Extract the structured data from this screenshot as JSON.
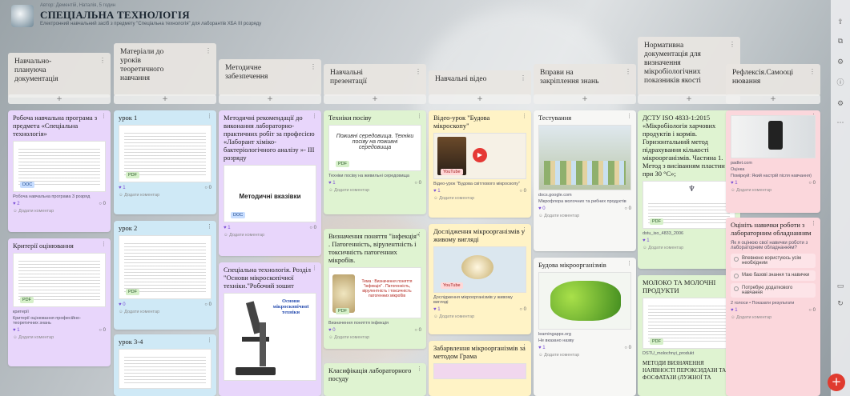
{
  "header": {
    "small": "Автор: Дементій, Наталія, 5 годин",
    "title": "СПЕЦІАЛЬНА ТЕХНОЛОГІЯ",
    "subtitle": "Електронний навчальний засіб з предмету \"Спеціальна технологія\" для лаборантів ХБА ІІІ розряду"
  },
  "columns": [
    {
      "title": "Навчально-\nплануюча\nдокументація",
      "cards": [
        {
          "title": "Робоча навчальна програма з предмета «Спеціальна технологія»",
          "badge": "DOC",
          "meta": "Робоча навчальна програма 3 розряд",
          "likes": "2",
          "comments": "0",
          "comment_label": "Додати коментар"
        },
        {
          "title": "Критерії оцінювання",
          "badge": "PDF",
          "meta": "критерії",
          "meta2": "Критерії оцінювання професійно-теоретичних знань",
          "likes": "1",
          "comments": "0",
          "comment_label": "Додати коментар"
        }
      ]
    },
    {
      "title": "Матеріали до\nуроків\nтеоретичного\nнавчання",
      "cards": [
        {
          "title": "урок 1",
          "badge": "PDF",
          "likes": "1",
          "comments": "0",
          "comment_label": "Додати коментар"
        },
        {
          "title": "урок 2",
          "badge": "PDF",
          "likes": "0",
          "comments": "0",
          "comment_label": "Додати коментар"
        },
        {
          "title": "урок 3-4"
        }
      ]
    },
    {
      "title": "Методичне\nзабезпечення",
      "cards": [
        {
          "title": "Методичні рекомендації до виконання лабораторно-практичних робіт за професією «Лаборант хіміко-бактеріологічного аналізу »- ІІІ розряду",
          "thumb_caption": "Методичні вказівки",
          "badge": "DOC",
          "likes": "1",
          "comments": "0",
          "comment_label": "Додати коментар"
        },
        {
          "title": "Спеціальна технологія. Розділ \"Основи мікроскопічної техніки.\"Робочий зошит",
          "thumb_caption": "Основи мікроскопічної техніки"
        }
      ]
    },
    {
      "title": "Навчальні\nпрезентації",
      "cards": [
        {
          "title": "Техніки посіву",
          "thumb_caption": "Поживні середовища. Техніки посіву на поживні середовища",
          "badge": "PDF",
          "meta": "Техніки посіву на живильні середовища",
          "likes": "1",
          "comments": "0",
          "comment_label": "Додати коментар"
        },
        {
          "title": "Визначення поняття \"інфекція\" . Патогенність, вірулентність і токсичність патогенних мікробів.",
          "thumb_caption": "Тема : Визначення поняття \"інфекція\" . Патогенність, вірулентність і токсичність патогенних мікробів",
          "badge": "PDF",
          "meta": "Визначення поняття інфекція",
          "likes": "0",
          "comments": "0",
          "comment_label": "Додати коментар"
        },
        {
          "title": "Класифікація лабораторного посуду"
        }
      ]
    },
    {
      "title": "Навчальні відео",
      "cards": [
        {
          "title": "Відео-урок \"Будова мікроскопу\"",
          "badge": "YouTube",
          "meta": "Відео-урок \"Будова світлового мікроскопу\"",
          "likes": "1",
          "comments": "0",
          "comment_label": "Додати коментар"
        },
        {
          "title": "Дослідження мікроорганізмів у живому вигляді",
          "badge": "YouTube",
          "meta": "Дослідження мікроорганізмів у живому вигляді",
          "likes": "1",
          "comments": "0",
          "comment_label": "Додати коментар"
        },
        {
          "title": "Забарвлення мікроорганізмів за методом Грама"
        }
      ]
    },
    {
      "title": "Вправи на\nзакріплення знань",
      "cards": [
        {
          "title": "Тестування",
          "meta": "docs.google.com",
          "meta2": "Мікрофлора молочних та рибних продуктів",
          "likes": "0",
          "comments": "0",
          "comment_label": "Додати коментар"
        },
        {
          "title": "Будова мікроорганізмів",
          "meta": "learningapps.org",
          "meta2": "Не вказано назву",
          "likes": "1",
          "comments": "0",
          "comment_label": "Додати коментар"
        }
      ]
    },
    {
      "title": "Нормативна\nдокументація для\nвизначення\nмікробіологічних\nпоказників якості",
      "cards": [
        {
          "title": "ДСТУ ISO 4833-1:2015 «Мікробіологія харчових продуктів і кормів. Горизонтальний метод підрахування кількості мікроорганізмів. Частина 1. Метод з висіванням пластин при 30 °С»;",
          "badge": "PDF",
          "meta": "dstu_iso_4833_2006",
          "likes": "1",
          "comments": "0",
          "comment_label": "Додати коментар"
        },
        {
          "title": "МОЛОКО ТА МОЛОЧНІ ПРОДУКТИ",
          "badge": "PDF",
          "meta": "DSTU_molochnyi_produkt",
          "meta2": "МЕТОДИ ВИЗНАЧЕННЯ НАЯВНОСТІ ПЕРОКСИДАЗИ ТА ФОСФАТАЗИ (ЛУЖНОЇ ТА"
        }
      ]
    },
    {
      "title": "Рефлексія.Самооці\nнювання",
      "cards": [
        {
          "title": "",
          "meta": "padlet.com",
          "meta0": "Оцінка",
          "meta2": "Поміркуй: Який настрій після навчання)",
          "likes": "1",
          "comments": "0",
          "comment_label": "Додати коментар"
        },
        {
          "title": "Оцініть навички роботи з лабораторним обладнанням",
          "question": "Як я оцінюю свої навички роботи з лабораторним обладнанням?",
          "options": [
            "Впевнено користуюсь усім необхідним",
            "Маю базові знання та навички",
            "Потребую додаткового навчання"
          ],
          "poll_footer": "2 голоси • Показати результати",
          "likes": "1",
          "comments": "0",
          "comment_label": "Додати коментар"
        }
      ]
    }
  ],
  "colors": {
    "accent": "#e03b2f",
    "like": "#7a4fd6"
  },
  "fab_label": "+"
}
